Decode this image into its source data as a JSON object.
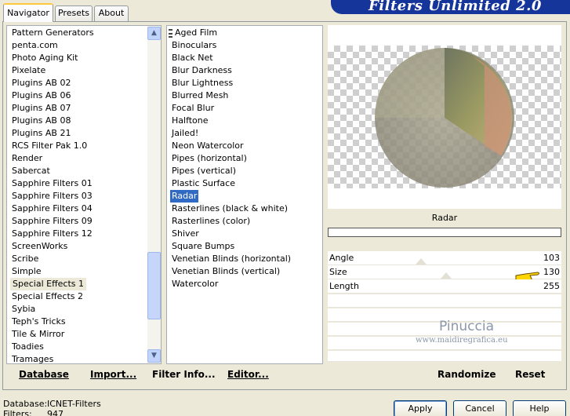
{
  "tabs": [
    {
      "label": "Navigator",
      "active": true
    },
    {
      "label": "Presets",
      "active": false
    },
    {
      "label": "About",
      "active": false
    }
  ],
  "banner": {
    "title": "Filters Unlimited 2.0",
    "color": "#15359a"
  },
  "categories": {
    "items": [
      "Pattern Generators",
      "penta.com",
      "Photo Aging Kit",
      "Pixelate",
      "Plugins AB 02",
      "Plugins AB 06",
      "Plugins AB 07",
      "Plugins AB 08",
      "Plugins AB 21",
      "RCS Filter Pak 1.0",
      "Render",
      "Sabercat",
      "Sapphire Filters 01",
      "Sapphire Filters 03",
      "Sapphire Filters 04",
      "Sapphire Filters 09",
      "Sapphire Filters 12",
      "ScreenWorks",
      "Scribe",
      "Simple",
      "Special Effects 1",
      "Special Effects 2",
      "Sybia",
      "Teph's Tricks",
      "Tile & Mirror",
      "Toadies",
      "Tramages"
    ],
    "selected": "Special Effects 1"
  },
  "filters": {
    "items": [
      "Aged Film",
      "Binoculars",
      "Black Net",
      "Blur Darkness",
      "Blur Lightness",
      "Blurred Mesh",
      "Focal Blur",
      "Halftone",
      "Jailed!",
      "Neon Watercolor",
      "Pipes (horizontal)",
      "Pipes (vertical)",
      "Plastic Surface",
      "Radar",
      "Rasterlines (black & white)",
      "Rasterlines (color)",
      "Shiver",
      "Square Bumps",
      "Venetian Blinds (horizontal)",
      "Venetian Blinds (vertical)",
      "Watercolor"
    ],
    "selected": "Radar"
  },
  "left_buttons": {
    "database": "Database",
    "import": "Import...",
    "filter_info": "Filter Info...",
    "editor": "Editor..."
  },
  "preview": {
    "filter_name": "Radar",
    "params": [
      {
        "label": "Angle",
        "value": "103"
      },
      {
        "label": "Size",
        "value": "130"
      },
      {
        "label": "Length",
        "value": "255"
      }
    ],
    "watermark_name": "Pinuccia",
    "watermark_url": "www.maidiregrafica.eu"
  },
  "right_buttons": {
    "randomize": "Randomize",
    "reset": "Reset"
  },
  "status": {
    "database_label": "Database:",
    "database_value": "ICNET-Filters",
    "filters_label": "Filters:",
    "filters_value": "947"
  },
  "dialog_buttons": {
    "apply": "Apply",
    "cancel": "Cancel",
    "help": "Help"
  },
  "icons": {
    "scroll_up": "chevron-up-icon",
    "scroll_down": "chevron-down-icon",
    "pointer": "hand-pointer-icon"
  }
}
